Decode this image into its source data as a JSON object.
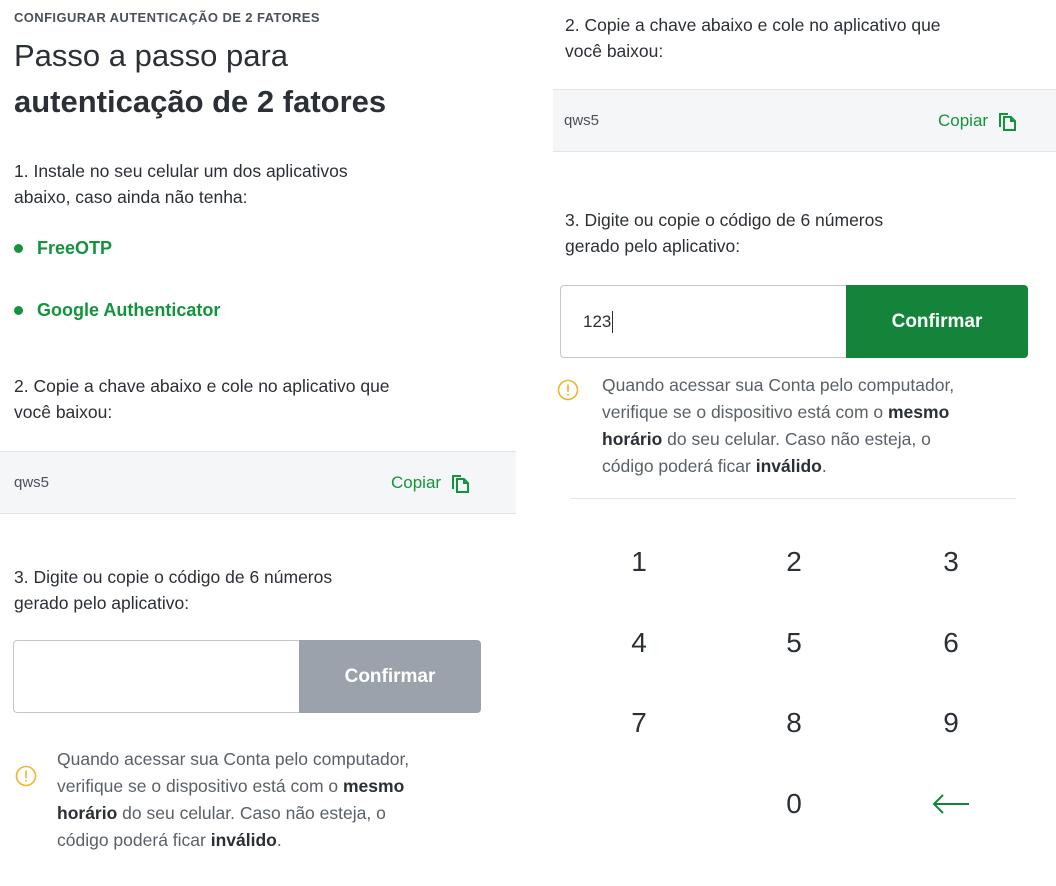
{
  "left": {
    "kicker": "CONFIGURAR AUTENTICAÇÃO DE 2 FATORES",
    "title_line1": "Passo a passo para",
    "title_line2": "autenticação de 2 fatores",
    "step1_line1": "1. Instale no seu celular um dos aplicativos",
    "step1_line2": "abaixo, caso ainda não tenha:",
    "apps": [
      "FreeOTP",
      "Google Authenticator"
    ],
    "step2_line1": "2. Copie a chave abaixo e cole no aplicativo que",
    "step2_line2": "você baixou:",
    "key_value": "qws5",
    "copy_label": "Copiar",
    "step3_line1": "3. Digite ou copie o código de 6 números",
    "step3_line2": "gerado pelo aplicativo:",
    "input_value": "",
    "confirm_label": "Confirmar",
    "warning": {
      "line1": "Quando acessar sua Conta pelo computador,",
      "line2_pre": "verifique se o dispositivo está com o ",
      "line2_bold": "mesmo",
      "line3_bold": "horário",
      "line3_post": " do seu celular. Caso não esteja, o",
      "line4_pre": "código poderá ficar ",
      "line4_bold": "inválido",
      "line4_post": "."
    }
  },
  "right": {
    "step2_line1": "2. Copie a chave abaixo e cole no aplicativo que",
    "step2_line2": "você baixou:",
    "key_value": "qws5",
    "copy_label": "Copiar",
    "step3_line1": "3. Digite ou copie o código de 6 números",
    "step3_line2": "gerado pelo aplicativo:",
    "input_value": "123",
    "confirm_label": "Confirmar",
    "warning": {
      "line1": "Quando acessar sua Conta pelo computador,",
      "line2_pre": "verifique se o dispositivo está com o ",
      "line2_bold": "mesmo",
      "line3_bold": "horário",
      "line3_post": " do seu celular. Caso não esteja, o",
      "line4_pre": "código poderá ficar ",
      "line4_bold": "inválido",
      "line4_post": "."
    },
    "keypad": [
      "1",
      "2",
      "3",
      "4",
      "5",
      "6",
      "7",
      "8",
      "9",
      "0"
    ],
    "backspace_icon": "arrow-left-icon"
  },
  "colors": {
    "accent_green": "#13943c",
    "button_green": "#13843a",
    "button_disabled": "#9ba2ab",
    "warning_yellow": "#f0b429"
  }
}
